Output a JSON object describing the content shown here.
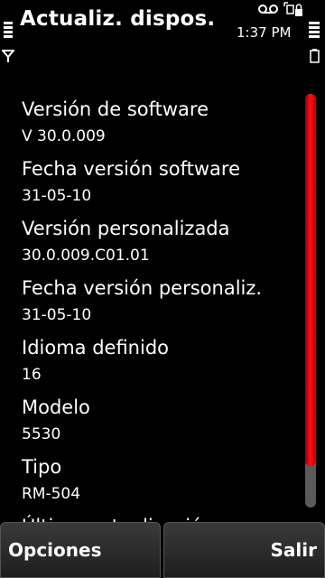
{
  "header": {
    "title": "Actualiz. dispos.",
    "time": "1:37 PM"
  },
  "details": [
    {
      "label": "Versión de software",
      "value": "V 30.0.009"
    },
    {
      "label": "Fecha versión software",
      "value": "31-05-10"
    },
    {
      "label": "Versión personalizada",
      "value": "30.0.009.C01.01"
    },
    {
      "label": "Fecha versión personaliz.",
      "value": "31-05-10"
    },
    {
      "label": "Idioma definido",
      "value": "16"
    },
    {
      "label": "Modelo",
      "value": "5530"
    },
    {
      "label": "Tipo",
      "value": "RM-504"
    },
    {
      "label": "Última actualización",
      "value": ""
    }
  ],
  "scrollbar": {
    "position_fraction": 0.0,
    "visible_fraction": 0.9,
    "thumb_color": "#e00000"
  },
  "softkeys": {
    "left": "Opciones",
    "right": "Salir"
  },
  "colors": {
    "background": "#000000",
    "text": "#ffffff",
    "accent": "#e00000"
  },
  "icons": [
    "signal-strength-icon",
    "antenna-icon",
    "voicemail-icon",
    "sim-lock-icon",
    "battery-level-icon",
    "battery-icon"
  ]
}
